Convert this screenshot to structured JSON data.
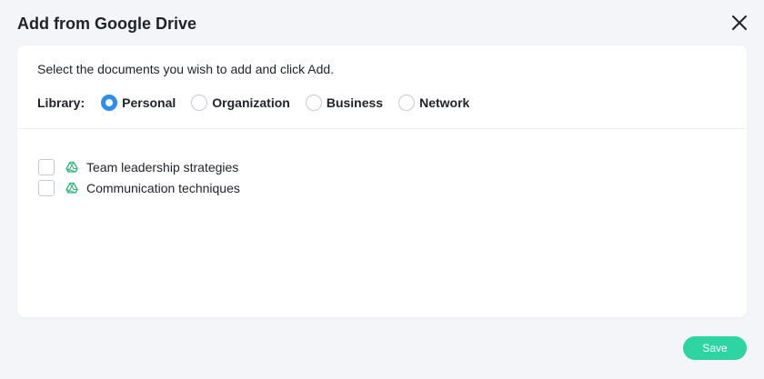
{
  "dialog": {
    "title": "Add from Google Drive",
    "close_icon": "close-icon"
  },
  "card": {
    "instruction": "Select the documents you wish to add and click Add.",
    "library": {
      "label": "Library:",
      "selected": "Personal",
      "options": [
        {
          "label": "Personal",
          "checked": true
        },
        {
          "label": "Organization",
          "checked": false
        },
        {
          "label": "Business",
          "checked": false
        },
        {
          "label": "Network",
          "checked": false
        }
      ]
    },
    "documents": [
      {
        "name": "Team leadership strategies",
        "checked": false,
        "icon": "google-drive-icon"
      },
      {
        "name": "Communication techniques",
        "checked": false,
        "icon": "google-drive-icon"
      }
    ]
  },
  "footer": {
    "save_label": "Save"
  },
  "colors": {
    "accent": "#2d8cf0",
    "save_button": "#2fd4a3",
    "drive_icon": "#2fb67c",
    "background": "#f4f5f9"
  }
}
